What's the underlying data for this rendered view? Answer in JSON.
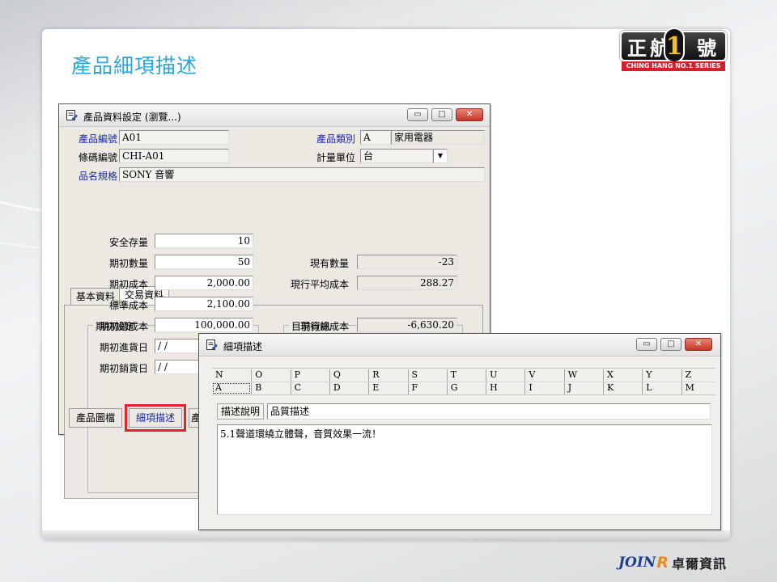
{
  "slide": {
    "title": "產品細項描述",
    "brand_main": "正航",
    "brand_num": "1",
    "brand_suffix": "號",
    "brand_sub": "CHING HANG NO.1 SERIES",
    "footer_logo": "JOIN",
    "footer_r": "R",
    "footer_company": "卓爾資訊"
  },
  "product_window": {
    "title": "產品資料設定 (瀏覽...)",
    "labels": {
      "product_no": "產品編號",
      "barcode": "條碼編號",
      "name_spec": "品名規格",
      "category": "產品類別",
      "unit": "計量單位"
    },
    "values": {
      "product_no": "A01",
      "barcode": "CHI-A01",
      "name_spec": "SONY 音響",
      "category_code": "A",
      "category_name": "家用電器",
      "unit": "台"
    },
    "tabs": [
      "基本資料",
      "交易資料"
    ],
    "opening": {
      "title": "期初設定",
      "rows": [
        {
          "label": "安全存量",
          "value": "10"
        },
        {
          "label": "期初數量",
          "value": "50"
        },
        {
          "label": "期初成本",
          "value": "2,000.00"
        },
        {
          "label": "標準成本",
          "value": "2,100.00"
        },
        {
          "label": "期初總成本",
          "value": "100,000.00"
        },
        {
          "label": "期初進貨日",
          "value": "/ /"
        },
        {
          "label": "期初銷貨日",
          "value": "/ /"
        }
      ]
    },
    "current": {
      "title": "目前資訊",
      "rows": [
        {
          "label": "現有數量",
          "value": "-23"
        },
        {
          "label": "現行平均成本",
          "value": "288.27"
        },
        {
          "label": "現行總成本",
          "value": "-6,630.20"
        }
      ]
    },
    "bottom_tabs": [
      "產品圖檔",
      "細項描述",
      "產"
    ]
  },
  "detail_window": {
    "title": "細項描述",
    "alpha_row1": [
      "N",
      "O",
      "P",
      "Q",
      "R",
      "S",
      "T",
      "U",
      "V",
      "W",
      "X",
      "Y",
      "Z"
    ],
    "alpha_row2": [
      "A",
      "B",
      "C",
      "D",
      "E",
      "F",
      "G",
      "H",
      "I",
      "J",
      "K",
      "L",
      "M"
    ],
    "desc_label": "描述說明",
    "desc_value": "品質描述",
    "content": "5.1聲道環繞立體聲，音質效果一流！"
  }
}
